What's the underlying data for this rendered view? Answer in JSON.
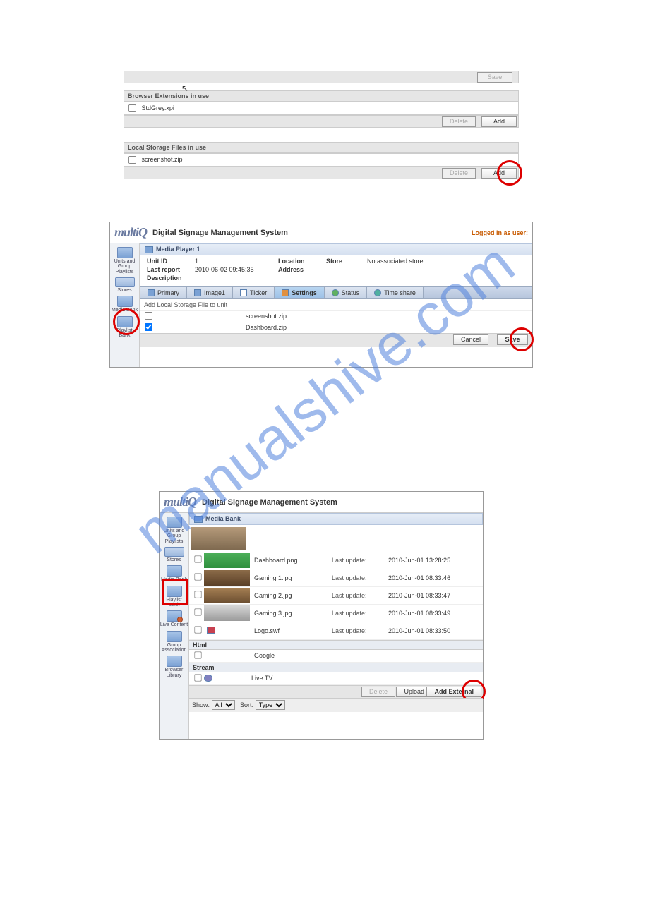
{
  "section1": {
    "save_btn": "Save",
    "browser_ext_header": "Browser Extensions in use",
    "browser_ext_item": "StdGrey.xpi",
    "local_storage_header": "Local Storage Files in use",
    "local_storage_item": "screenshot.zip",
    "delete_btn": "Delete",
    "add_btn": "Add"
  },
  "section2": {
    "logo": "multiQ",
    "title": "Digital Signage Management System",
    "logged": "Logged in as user:",
    "sidebar": [
      "Units\nand\nGroup\nPlaylists",
      "Stores",
      "Media\nBank",
      "Playlist\nBank"
    ],
    "panel_title": "Media Player 1",
    "info": {
      "unit_id_label": "Unit ID",
      "unit_id": "1",
      "location_label": "Location",
      "store_label": "Store",
      "store_val": "No associated store",
      "last_report_label": "Last report",
      "last_report": "2010-06-02 09:45:35",
      "address_label": "Address",
      "description_label": "Description"
    },
    "tabs": [
      "Primary",
      "Image1",
      "Ticker",
      "Settings",
      "Status",
      "Time share"
    ],
    "subhead": "Add Local Storage File to unit",
    "files": [
      "screenshot.zip",
      "Dashboard.zip"
    ],
    "cancel": "Cancel",
    "save": "Save"
  },
  "section3": {
    "logo": "multiQ",
    "title": "Digital Signage Management System",
    "sidebar": [
      "Units\nand\nGroup\nPlaylists",
      "Stores",
      "Media\nBank",
      "Playlist\nBank",
      "Live\nContent",
      "Group\nAssociation",
      "Browser\nLibrary"
    ],
    "panel_title": "Media Bank",
    "rows": [
      {
        "name": "Dashboard.png",
        "label": "Last update:",
        "date": "2010-Jun-01 13:28:25",
        "thumb": "green"
      },
      {
        "name": "Gaming 1.jpg",
        "label": "Last update:",
        "date": "2010-Jun-01 08:33:46",
        "thumb": "horse1"
      },
      {
        "name": "Gaming 2.jpg",
        "label": "Last update:",
        "date": "2010-Jun-01 08:33:47",
        "thumb": "horse2"
      },
      {
        "name": "Gaming 3.jpg",
        "label": "Last update:",
        "date": "2010-Jun-01 08:33:49",
        "thumb": "cards"
      },
      {
        "name": "Logo.swf",
        "label": "Last update:",
        "date": "2010-Jun-01 08:33:50",
        "thumb": ""
      }
    ],
    "html_hdr": "Html",
    "html_item": "Google",
    "stream_hdr": "Stream",
    "stream_item": "Live TV",
    "delete": "Delete",
    "upload": "Upload",
    "add_external": "Add External",
    "show_label": "Show:",
    "show_val": "All",
    "sort_label": "Sort:",
    "sort_val": "Type"
  }
}
